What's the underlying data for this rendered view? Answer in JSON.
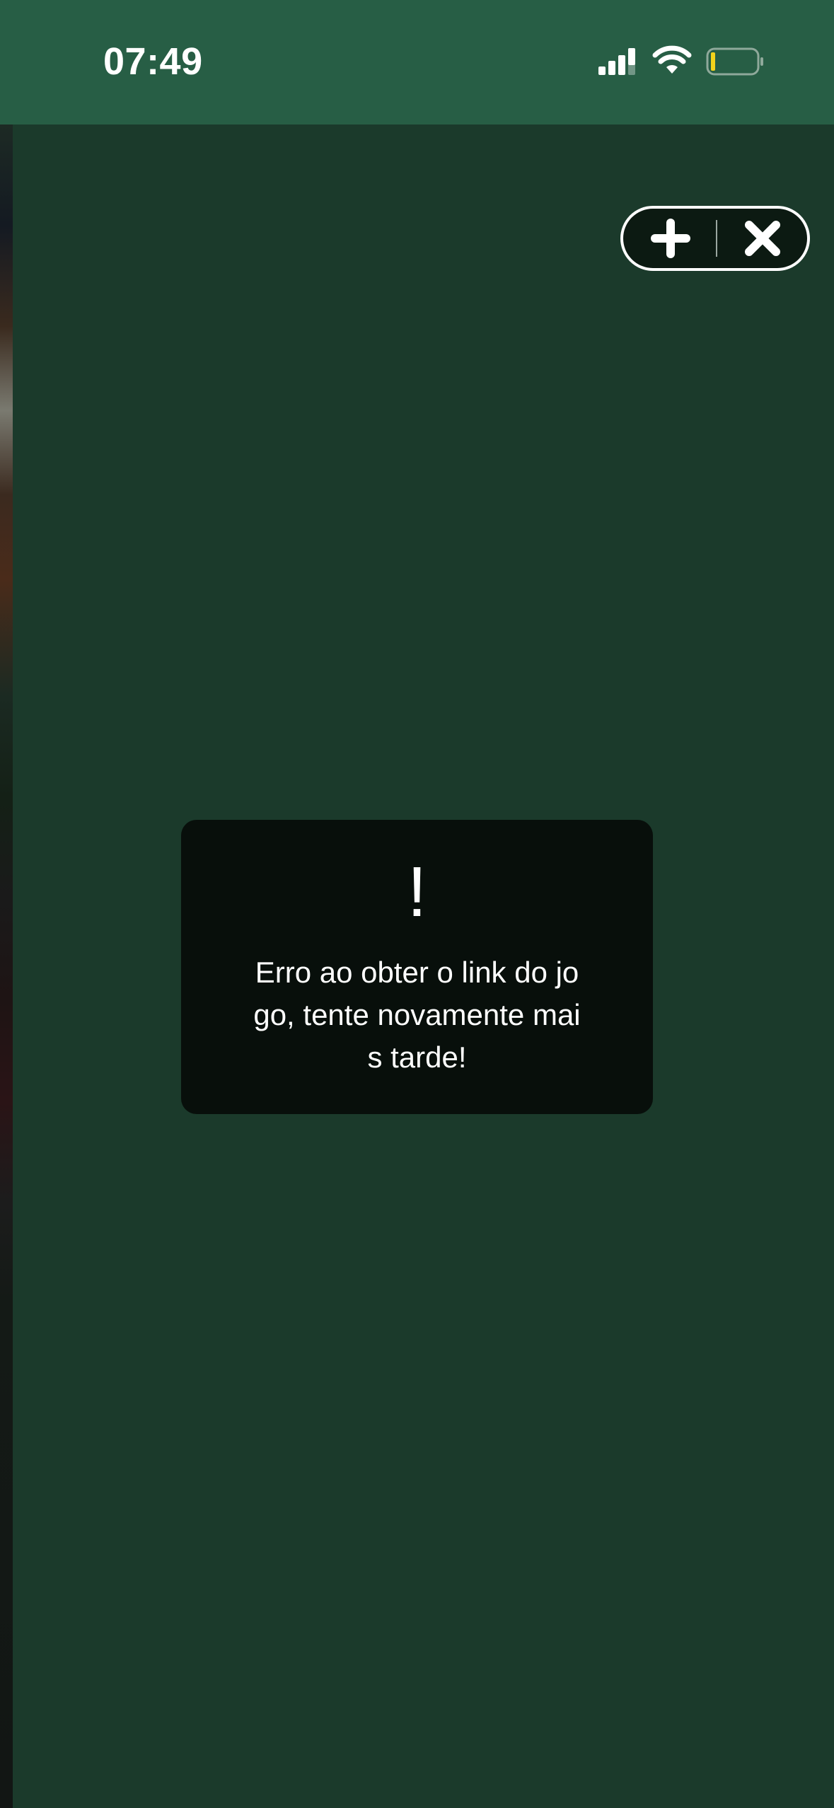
{
  "status_bar": {
    "time": "07:49",
    "signal_icon": "signal-strength-icon",
    "wifi_icon": "wifi-icon",
    "battery_icon": "battery-low-icon",
    "battery_level": 0.1,
    "battery_fill_color": "#f3d41b"
  },
  "capsule": {
    "add_icon": "plus-icon",
    "close_icon": "close-icon"
  },
  "toast": {
    "icon_text": "!",
    "message": "Erro ao obter o link do jo\ngo, tente novamente mai\ns tarde!"
  },
  "colors": {
    "status_bar_bg": "#275e45",
    "page_bg": "#1b3a2b",
    "toast_bg": "#080f0b",
    "text": "#ffffff"
  }
}
